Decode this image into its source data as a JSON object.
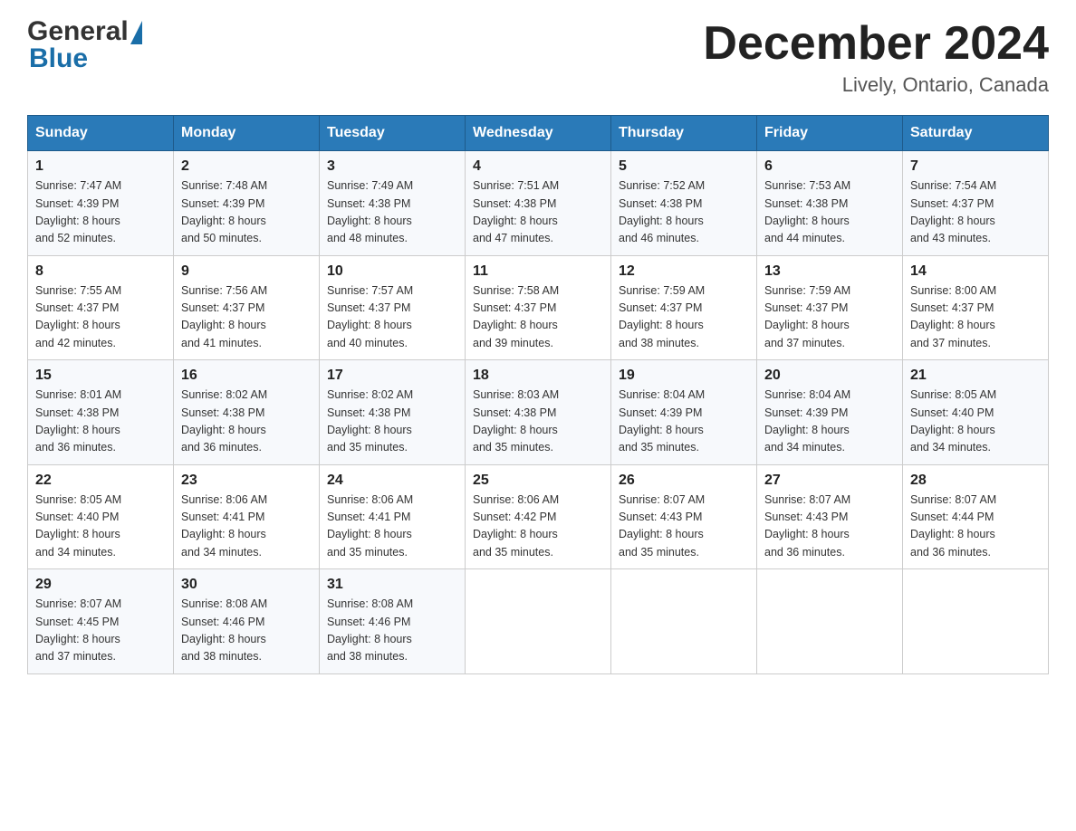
{
  "header": {
    "month_title": "December 2024",
    "location": "Lively, Ontario, Canada"
  },
  "days_of_week": [
    "Sunday",
    "Monday",
    "Tuesday",
    "Wednesday",
    "Thursday",
    "Friday",
    "Saturday"
  ],
  "weeks": [
    [
      {
        "day": "1",
        "sunrise": "7:47 AM",
        "sunset": "4:39 PM",
        "daylight": "8 hours and 52 minutes."
      },
      {
        "day": "2",
        "sunrise": "7:48 AM",
        "sunset": "4:39 PM",
        "daylight": "8 hours and 50 minutes."
      },
      {
        "day": "3",
        "sunrise": "7:49 AM",
        "sunset": "4:38 PM",
        "daylight": "8 hours and 48 minutes."
      },
      {
        "day": "4",
        "sunrise": "7:51 AM",
        "sunset": "4:38 PM",
        "daylight": "8 hours and 47 minutes."
      },
      {
        "day": "5",
        "sunrise": "7:52 AM",
        "sunset": "4:38 PM",
        "daylight": "8 hours and 46 minutes."
      },
      {
        "day": "6",
        "sunrise": "7:53 AM",
        "sunset": "4:38 PM",
        "daylight": "8 hours and 44 minutes."
      },
      {
        "day": "7",
        "sunrise": "7:54 AM",
        "sunset": "4:37 PM",
        "daylight": "8 hours and 43 minutes."
      }
    ],
    [
      {
        "day": "8",
        "sunrise": "7:55 AM",
        "sunset": "4:37 PM",
        "daylight": "8 hours and 42 minutes."
      },
      {
        "day": "9",
        "sunrise": "7:56 AM",
        "sunset": "4:37 PM",
        "daylight": "8 hours and 41 minutes."
      },
      {
        "day": "10",
        "sunrise": "7:57 AM",
        "sunset": "4:37 PM",
        "daylight": "8 hours and 40 minutes."
      },
      {
        "day": "11",
        "sunrise": "7:58 AM",
        "sunset": "4:37 PM",
        "daylight": "8 hours and 39 minutes."
      },
      {
        "day": "12",
        "sunrise": "7:59 AM",
        "sunset": "4:37 PM",
        "daylight": "8 hours and 38 minutes."
      },
      {
        "day": "13",
        "sunrise": "7:59 AM",
        "sunset": "4:37 PM",
        "daylight": "8 hours and 37 minutes."
      },
      {
        "day": "14",
        "sunrise": "8:00 AM",
        "sunset": "4:37 PM",
        "daylight": "8 hours and 37 minutes."
      }
    ],
    [
      {
        "day": "15",
        "sunrise": "8:01 AM",
        "sunset": "4:38 PM",
        "daylight": "8 hours and 36 minutes."
      },
      {
        "day": "16",
        "sunrise": "8:02 AM",
        "sunset": "4:38 PM",
        "daylight": "8 hours and 36 minutes."
      },
      {
        "day": "17",
        "sunrise": "8:02 AM",
        "sunset": "4:38 PM",
        "daylight": "8 hours and 35 minutes."
      },
      {
        "day": "18",
        "sunrise": "8:03 AM",
        "sunset": "4:38 PM",
        "daylight": "8 hours and 35 minutes."
      },
      {
        "day": "19",
        "sunrise": "8:04 AM",
        "sunset": "4:39 PM",
        "daylight": "8 hours and 35 minutes."
      },
      {
        "day": "20",
        "sunrise": "8:04 AM",
        "sunset": "4:39 PM",
        "daylight": "8 hours and 34 minutes."
      },
      {
        "day": "21",
        "sunrise": "8:05 AM",
        "sunset": "4:40 PM",
        "daylight": "8 hours and 34 minutes."
      }
    ],
    [
      {
        "day": "22",
        "sunrise": "8:05 AM",
        "sunset": "4:40 PM",
        "daylight": "8 hours and 34 minutes."
      },
      {
        "day": "23",
        "sunrise": "8:06 AM",
        "sunset": "4:41 PM",
        "daylight": "8 hours and 34 minutes."
      },
      {
        "day": "24",
        "sunrise": "8:06 AM",
        "sunset": "4:41 PM",
        "daylight": "8 hours and 35 minutes."
      },
      {
        "day": "25",
        "sunrise": "8:06 AM",
        "sunset": "4:42 PM",
        "daylight": "8 hours and 35 minutes."
      },
      {
        "day": "26",
        "sunrise": "8:07 AM",
        "sunset": "4:43 PM",
        "daylight": "8 hours and 35 minutes."
      },
      {
        "day": "27",
        "sunrise": "8:07 AM",
        "sunset": "4:43 PM",
        "daylight": "8 hours and 36 minutes."
      },
      {
        "day": "28",
        "sunrise": "8:07 AM",
        "sunset": "4:44 PM",
        "daylight": "8 hours and 36 minutes."
      }
    ],
    [
      {
        "day": "29",
        "sunrise": "8:07 AM",
        "sunset": "4:45 PM",
        "daylight": "8 hours and 37 minutes."
      },
      {
        "day": "30",
        "sunrise": "8:08 AM",
        "sunset": "4:46 PM",
        "daylight": "8 hours and 38 minutes."
      },
      {
        "day": "31",
        "sunrise": "8:08 AM",
        "sunset": "4:46 PM",
        "daylight": "8 hours and 38 minutes."
      },
      null,
      null,
      null,
      null
    ]
  ],
  "labels": {
    "sunrise": "Sunrise:",
    "sunset": "Sunset:",
    "daylight": "Daylight:"
  }
}
